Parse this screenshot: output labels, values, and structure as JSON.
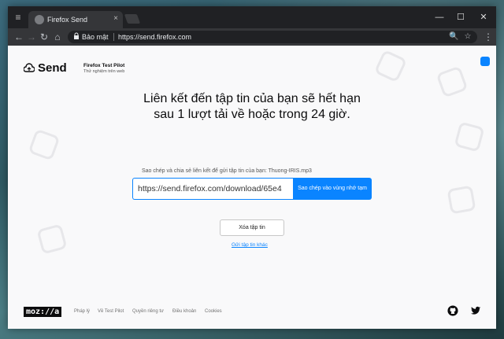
{
  "browser": {
    "tab_title": "Firefox Send",
    "tab_close": "×",
    "secure_label": "Bảo mật",
    "url": "https://send.firefox.com",
    "window_controls": {
      "minimize": "—",
      "maximize": "☐",
      "close": "✕"
    },
    "nav": {
      "back": "←",
      "forward": "→",
      "reload": "↻",
      "home": "⌂"
    },
    "omnibox_icons": {
      "zoom": "🔍",
      "bookmark": "☆"
    },
    "menu": "⋮"
  },
  "header": {
    "logo_text": "Send",
    "pilot_title": "Firefox Test Pilot",
    "pilot_subtitle": "Thử nghiệm trên web"
  },
  "main": {
    "headline": "Liên kết đến tập tin của bạn sẽ hết hạn sau 1 lượt tải về hoặc trong 24 giờ.",
    "copy_label": "Sao chép và chia sẻ liên kết để gửi tập tin của bạn: Thuong-IRIS.mp3",
    "share_link": "https://send.firefox.com/download/65e4",
    "copy_button": "Sao chép vào vùng nhớ tạm",
    "delete_button": "Xóa tập tin",
    "send_another": "Gửi tập tin khác"
  },
  "footer": {
    "mozilla_logo": "moz://a",
    "links": [
      "Pháp lý",
      "Về Test Pilot",
      "Quyền riêng tư",
      "Điều khoản",
      "Cookies"
    ]
  },
  "colors": {
    "accent": "#0a84ff",
    "page_bg": "#f9f9fa",
    "chrome_dark": "#202124"
  }
}
